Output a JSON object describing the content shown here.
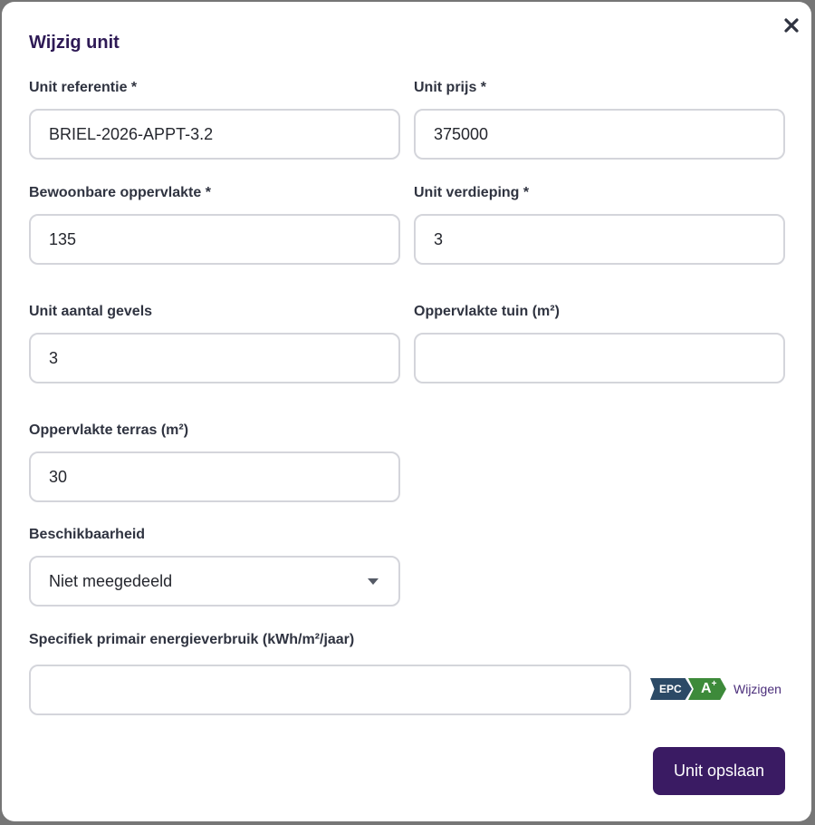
{
  "modal": {
    "title": "Wijzig unit",
    "close_icon": "close-icon"
  },
  "fields": {
    "reference": {
      "label": "Unit referentie *",
      "value": "BRIEL-2026-APPT-3.2"
    },
    "price": {
      "label": "Unit prijs *",
      "value": "375000"
    },
    "living_area": {
      "label": "Bewoonbare oppervlakte *",
      "value": "135"
    },
    "floor": {
      "label": "Unit verdieping *",
      "value": "3"
    },
    "facades": {
      "label": "Unit aantal gevels",
      "value": "3"
    },
    "garden_area": {
      "label": "Oppervlakte tuin (m²)",
      "value": ""
    },
    "terrace_area": {
      "label": "Oppervlakte terras (m²)",
      "value": "30"
    },
    "availability": {
      "label": "Beschikbaarheid",
      "selected": "Niet meegedeeld"
    },
    "energy_use": {
      "label": "Specifiek primair energieverbruik (kWh/m²/jaar)",
      "value": ""
    }
  },
  "epc": {
    "badge_label": "EPC",
    "rating": "A",
    "rating_suffix": "+",
    "change_link": "Wijzigen",
    "colors": {
      "label_bg": "#2c4a66",
      "rating_bg": "#3d8a3a"
    }
  },
  "actions": {
    "save_label": "Unit opslaan"
  },
  "colors": {
    "title": "#2e1a55",
    "primary_button": "#3a1b63",
    "input_border": "#d4d5db"
  }
}
